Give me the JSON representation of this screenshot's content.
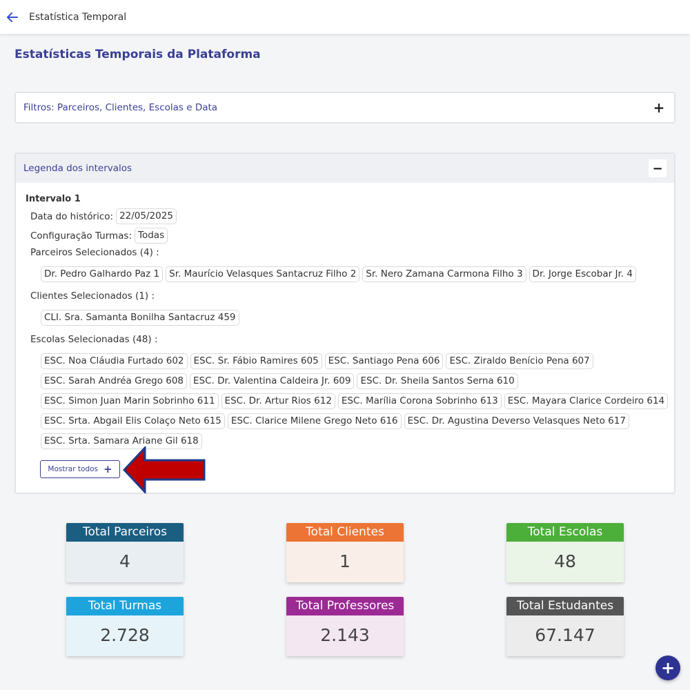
{
  "topbar": {
    "title": "Estatística Temporal"
  },
  "page_title": "Estatísticas Temporais da Plataforma",
  "filters": {
    "title": "Filtros: Parceiros, Clientes, Escolas e Data",
    "toggle": "+"
  },
  "legend": {
    "title": "Legenda dos intervalos",
    "toggle": "−",
    "interval_title": "Intervalo 1",
    "date_label": "Data do histórico:",
    "date_value": "22/05/2025",
    "config_label": "Configuração Turmas:",
    "config_value": "Todas",
    "parceiros_label": "Parceiros Selecionados (4) :",
    "parceiros": [
      "Dr. Pedro Galhardo Paz 1",
      "Sr. Maurício Velasques Santacruz Filho 2",
      "Sr. Nero Zamana Carmona Filho 3",
      "Dr. Jorge Escobar Jr. 4"
    ],
    "clientes_label": "Clientes Selecionados (1) :",
    "clientes": [
      "CLI. Sra. Samanta Bonilha Santacruz 459"
    ],
    "escolas_label": "Escolas Selecionadas (48) :",
    "escolas": [
      "ESC. Noa Cláudia Furtado 602",
      "ESC. Sr. Fábio Ramires 605",
      "ESC. Santiago Pena 606",
      "ESC. Ziraldo Benício Pena 607",
      "ESC. Sarah Andréa Grego 608",
      "ESC. Dr. Valentina Caldeira Jr. 609",
      "ESC. Dr. Sheila Santos Serna 610",
      "ESC. Simon Juan Marin Sobrinho 611",
      "ESC. Dr. Artur Rios 612",
      "ESC. Marília Corona Sobrinho 613",
      "ESC. Mayara Clarice Cordeiro 614",
      "ESC. Srta. Abgail Elis Colaço Neto 615",
      "ESC. Clarice Milene Grego Neto 616",
      "ESC. Dr. Agustina Deverso Velasques Neto 617",
      "ESC. Srta. Samara Ariane Gil 618"
    ],
    "show_all_label": "Mostrar todos",
    "show_all_icon": "+"
  },
  "stats": [
    {
      "label": "Total Parceiros",
      "value": "4",
      "head_color": "#1b5e82",
      "body_color": "#e8eef2"
    },
    {
      "label": "Total Clientes",
      "value": "1",
      "head_color": "#ec7434",
      "body_color": "#faeee8"
    },
    {
      "label": "Total Escolas",
      "value": "48",
      "head_color": "#4caf39",
      "body_color": "#eaf5e8"
    },
    {
      "label": "Total Turmas",
      "value": "2.728",
      "head_color": "#1ea4dc",
      "body_color": "#e6f4fa"
    },
    {
      "label": "Total Professores",
      "value": "2.143",
      "head_color": "#9c2a94",
      "body_color": "#f3e7f2"
    },
    {
      "label": "Total Estudantes",
      "value": "67.147",
      "head_color": "#555555",
      "body_color": "#ececec"
    }
  ],
  "fab": {
    "icon": "+"
  },
  "colors": {
    "primary": "#3a3f94",
    "arrow_fill": "#c00000",
    "arrow_stroke": "#1f3a8a"
  }
}
